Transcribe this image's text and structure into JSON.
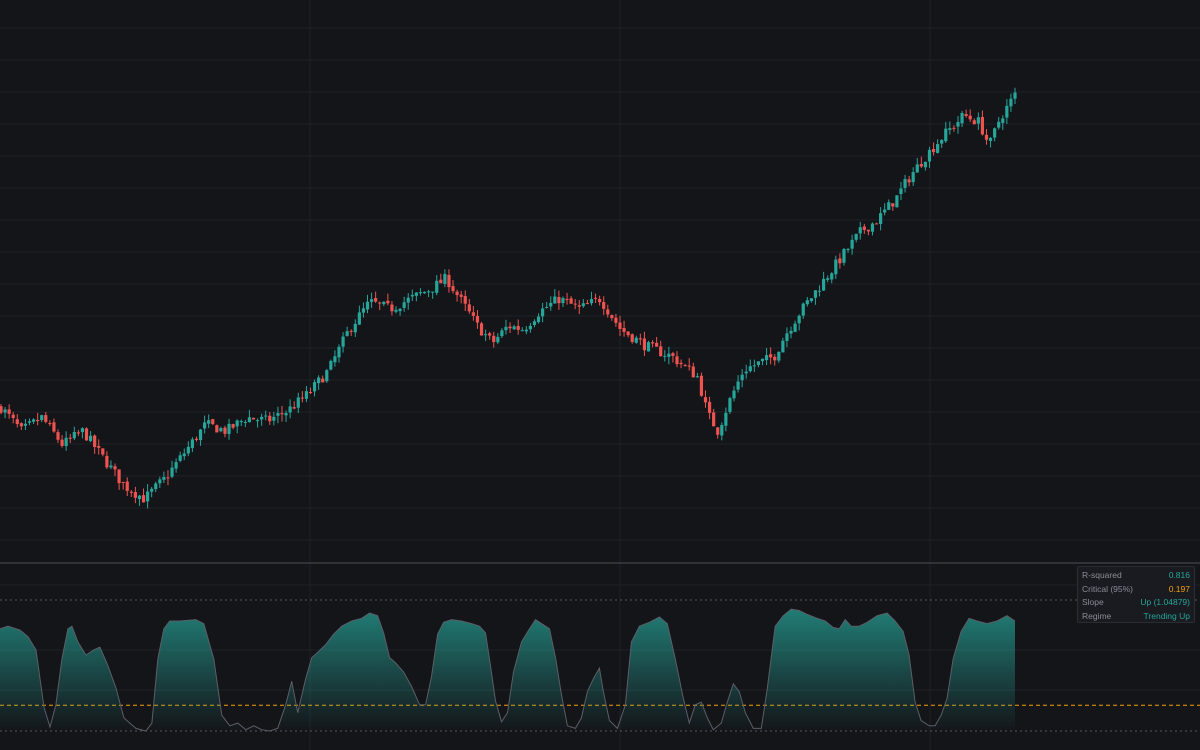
{
  "colors": {
    "background": "#141519",
    "grid": "#1f2127",
    "up": "#26a69a",
    "down": "#ef5350",
    "critical_line": "#f59f0b",
    "divider": "#3a3d45"
  },
  "stats_panel": {
    "rows": [
      {
        "label": "R-squared",
        "value": "0.816",
        "tone": "teal"
      },
      {
        "label": "Critical (95%)",
        "value": "0.197",
        "tone": "orange"
      },
      {
        "label": "Slope",
        "value": "Up (1.04879)",
        "tone": "teal"
      },
      {
        "label": "Regime",
        "value": "Trending Up",
        "tone": "teal"
      }
    ]
  },
  "chart_data": [
    {
      "type": "candlestick",
      "title": "",
      "grid": true,
      "candle_count": 250,
      "price_path": [
        [
          0,
          65
        ],
        [
          8,
          58
        ],
        [
          16,
          62
        ],
        [
          24,
          54
        ],
        [
          32,
          58
        ],
        [
          40,
          50
        ],
        [
          48,
          42
        ],
        [
          56,
          38
        ],
        [
          64,
          44
        ],
        [
          72,
          52
        ],
        [
          80,
          60
        ],
        [
          88,
          58
        ],
        [
          96,
          62
        ],
        [
          104,
          61
        ],
        [
          112,
          64
        ],
        [
          120,
          69
        ],
        [
          128,
          76
        ],
        [
          136,
          88
        ],
        [
          144,
          96
        ],
        [
          152,
          94
        ],
        [
          160,
          97
        ],
        [
          168,
          100
        ],
        [
          174,
          103
        ],
        [
          180,
          96
        ],
        [
          186,
          89
        ],
        [
          192,
          84
        ],
        [
          198,
          89
        ],
        [
          204,
          88
        ],
        [
          210,
          93
        ],
        [
          218,
          97
        ],
        [
          226,
          94
        ],
        [
          234,
          97
        ],
        [
          242,
          88
        ],
        [
          252,
          83
        ],
        [
          262,
          80
        ],
        [
          272,
          74
        ],
        [
          276,
          63
        ],
        [
          280,
          58
        ],
        [
          284,
          66
        ],
        [
          290,
          76
        ],
        [
          296,
          78
        ],
        [
          302,
          80
        ],
        [
          306,
          86
        ],
        [
          312,
          93
        ],
        [
          320,
          101
        ],
        [
          328,
          109
        ],
        [
          336,
          117
        ],
        [
          342,
          120
        ],
        [
          350,
          127
        ],
        [
          354,
          132
        ],
        [
          360,
          138
        ],
        [
          368,
          145
        ],
        [
          376,
          151
        ],
        [
          382,
          149
        ],
        [
          386,
          142
        ],
        [
          390,
          150
        ],
        [
          396,
          157
        ]
      ],
      "colors": {
        "up": "#26a69a",
        "down": "#ef5350"
      }
    },
    {
      "type": "area",
      "title": "",
      "grid": true,
      "ylim": [
        0,
        1
      ],
      "reference_lines": [
        {
          "value": 0.197,
          "label": "Critical (95%)",
          "color": "#f59f0b",
          "style": "dashed"
        },
        {
          "value": 1.0,
          "style": "dotted"
        },
        {
          "value": 0.0,
          "style": "dotted"
        }
      ],
      "series": [
        {
          "values": [
            [
              0,
              0.78
            ],
            [
              8,
              0.8
            ],
            [
              20,
              0.77
            ],
            [
              28,
              0.72
            ],
            [
              36,
              0.62
            ],
            [
              44,
              0.18
            ],
            [
              50,
              0.03
            ],
            [
              56,
              0.2
            ],
            [
              62,
              0.55
            ],
            [
              68,
              0.78
            ],
            [
              72,
              0.8
            ],
            [
              78,
              0.68
            ],
            [
              86,
              0.58
            ],
            [
              94,
              0.62
            ],
            [
              100,
              0.64
            ],
            [
              108,
              0.5
            ],
            [
              116,
              0.33
            ],
            [
              124,
              0.1
            ],
            [
              136,
              0.02
            ],
            [
              146,
              0.0
            ],
            [
              152,
              0.06
            ],
            [
              158,
              0.55
            ],
            [
              164,
              0.78
            ],
            [
              170,
              0.84
            ],
            [
              180,
              0.84
            ],
            [
              196,
              0.85
            ],
            [
              204,
              0.82
            ],
            [
              214,
              0.55
            ],
            [
              222,
              0.12
            ],
            [
              230,
              0.04
            ],
            [
              238,
              0.06
            ],
            [
              246,
              0.01
            ],
            [
              254,
              0.04
            ],
            [
              262,
              0.01
            ],
            [
              270,
              0.0
            ],
            [
              278,
              0.02
            ],
            [
              286,
              0.2
            ],
            [
              292,
              0.38
            ],
            [
              298,
              0.14
            ],
            [
              306,
              0.4
            ],
            [
              312,
              0.56
            ],
            [
              318,
              0.6
            ],
            [
              326,
              0.66
            ],
            [
              334,
              0.74
            ],
            [
              342,
              0.8
            ],
            [
              352,
              0.84
            ],
            [
              362,
              0.86
            ],
            [
              370,
              0.9
            ],
            [
              378,
              0.88
            ],
            [
              384,
              0.75
            ],
            [
              390,
              0.56
            ],
            [
              396,
              0.52
            ],
            [
              404,
              0.45
            ],
            [
              412,
              0.34
            ],
            [
              420,
              0.2
            ],
            [
              426,
              0.2
            ],
            [
              432,
              0.42
            ],
            [
              438,
              0.74
            ],
            [
              444,
              0.83
            ],
            [
              452,
              0.85
            ],
            [
              462,
              0.84
            ],
            [
              472,
              0.82
            ],
            [
              480,
              0.8
            ],
            [
              486,
              0.75
            ],
            [
              490,
              0.55
            ],
            [
              496,
              0.23
            ],
            [
              502,
              0.07
            ],
            [
              508,
              0.14
            ],
            [
              514,
              0.45
            ],
            [
              522,
              0.68
            ],
            [
              530,
              0.78
            ],
            [
              536,
              0.85
            ],
            [
              542,
              0.82
            ],
            [
              550,
              0.78
            ],
            [
              556,
              0.56
            ],
            [
              562,
              0.28
            ],
            [
              568,
              0.04
            ],
            [
              576,
              0.02
            ],
            [
              582,
              0.1
            ],
            [
              588,
              0.3
            ],
            [
              594,
              0.4
            ],
            [
              600,
              0.48
            ],
            [
              604,
              0.3
            ],
            [
              610,
              0.08
            ],
            [
              618,
              0.02
            ],
            [
              626,
              0.2
            ],
            [
              632,
              0.68
            ],
            [
              640,
              0.8
            ],
            [
              650,
              0.83
            ],
            [
              660,
              0.87
            ],
            [
              668,
              0.82
            ],
            [
              676,
              0.55
            ],
            [
              684,
              0.25
            ],
            [
              690,
              0.06
            ],
            [
              696,
              0.2
            ],
            [
              702,
              0.22
            ],
            [
              708,
              0.1
            ],
            [
              714,
              0.01
            ],
            [
              722,
              0.06
            ],
            [
              728,
              0.22
            ],
            [
              734,
              0.36
            ],
            [
              740,
              0.3
            ],
            [
              746,
              0.14
            ],
            [
              754,
              0.02
            ],
            [
              762,
              0.02
            ],
            [
              768,
              0.32
            ],
            [
              776,
              0.8
            ],
            [
              784,
              0.88
            ],
            [
              792,
              0.93
            ],
            [
              800,
              0.92
            ],
            [
              808,
              0.89
            ],
            [
              818,
              0.86
            ],
            [
              826,
              0.84
            ],
            [
              834,
              0.79
            ],
            [
              840,
              0.78
            ],
            [
              846,
              0.85
            ],
            [
              852,
              0.8
            ],
            [
              860,
              0.8
            ],
            [
              868,
              0.83
            ],
            [
              878,
              0.88
            ],
            [
              888,
              0.9
            ],
            [
              896,
              0.84
            ],
            [
              904,
              0.76
            ],
            [
              910,
              0.58
            ],
            [
              916,
              0.22
            ],
            [
              922,
              0.08
            ],
            [
              930,
              0.04
            ],
            [
              936,
              0.04
            ],
            [
              942,
              0.12
            ],
            [
              948,
              0.25
            ],
            [
              954,
              0.55
            ],
            [
              962,
              0.76
            ],
            [
              970,
              0.86
            ],
            [
              978,
              0.84
            ],
            [
              988,
              0.82
            ],
            [
              998,
              0.84
            ],
            [
              1008,
              0.88
            ],
            [
              1016,
              0.84
            ]
          ],
          "color_by_slope": {
            "up": "#26a69a",
            "down": "#ef5350"
          },
          "down_segments": [
            [
              50,
              144
            ],
            [
              504,
              566
            ],
            [
              620,
              696
            ],
            [
              718,
              752
            ]
          ]
        }
      ]
    }
  ]
}
